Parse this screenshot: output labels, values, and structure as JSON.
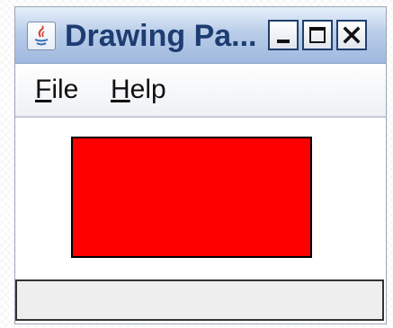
{
  "window": {
    "title": "Drawing Pa...",
    "app_icon": "java-icon",
    "buttons": [
      {
        "name": "minimize",
        "icon": "minimize-icon"
      },
      {
        "name": "maximize",
        "icon": "maximize-icon"
      },
      {
        "name": "close",
        "icon": "close-icon"
      }
    ]
  },
  "menubar": {
    "items": [
      {
        "label": "File",
        "mnemonic": "F"
      },
      {
        "label": "Help",
        "mnemonic": "H"
      }
    ]
  },
  "canvas": {
    "shapes": [
      {
        "type": "rectangle",
        "fill": "#ff0000",
        "stroke": "#000000"
      }
    ]
  },
  "statusbar": {
    "text": ""
  },
  "colors": {
    "title_text": "#1d3d72",
    "shape_fill": "#ff0000",
    "statusbar_bg": "#eeeeee"
  }
}
